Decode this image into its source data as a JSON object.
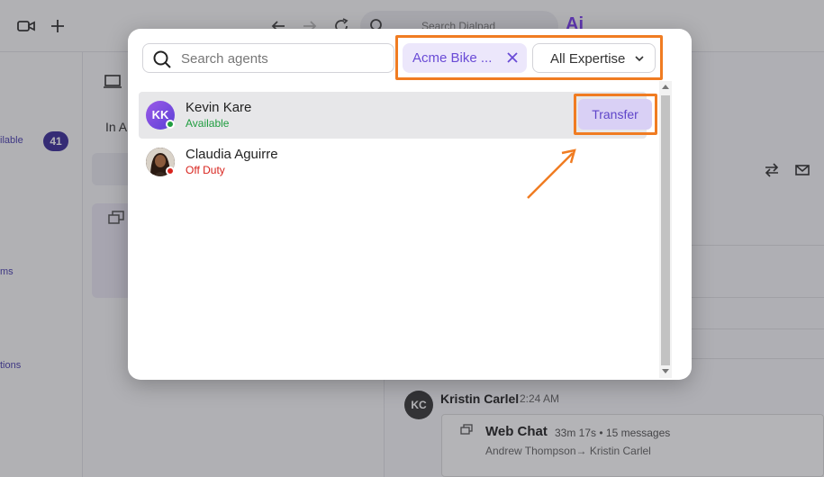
{
  "background": {
    "topbar": {
      "search_placeholder": "Search Dialpad",
      "ai_logo": "Ai"
    },
    "leftnav": {
      "items": [
        "ilable",
        "ms",
        "tions"
      ],
      "count_badge": "41"
    },
    "middle": {
      "tab_label": "In A"
    },
    "conversation": {
      "avatar_initials": "KC",
      "sender_name": "Kristin Carlel",
      "timestamp": "2:24 AM",
      "card_title": "Web Chat",
      "card_meta": "33m 17s • 15 messages",
      "card_participants": "Andrew Thompson→ Kristin Carlel"
    }
  },
  "modal": {
    "search": {
      "placeholder": "Search agents",
      "value": ""
    },
    "filter_chip": {
      "label": "Acme Bike ..."
    },
    "expertise_dropdown": {
      "selected": "All Expertise"
    },
    "agents": [
      {
        "initials": "KK",
        "name": "Kevin Kare",
        "status": "Available",
        "status_color": "#1f9d3f",
        "action": "Transfer"
      },
      {
        "initials": "",
        "name": "Claudia Aguirre",
        "status": "Off Duty",
        "status_color": "#d8231d"
      }
    ]
  },
  "colors": {
    "accent": "#6a4bd6",
    "highlight": "#f07c22",
    "available": "#1f9d3f",
    "off_duty": "#d8231d"
  },
  "icons": [
    "video-icon",
    "plus-icon",
    "back-icon",
    "forward-icon",
    "refresh-icon",
    "search-icon",
    "laptop-icon",
    "transfer-icon",
    "mail-icon",
    "chat-icon",
    "close-icon",
    "chevron-down-icon"
  ]
}
